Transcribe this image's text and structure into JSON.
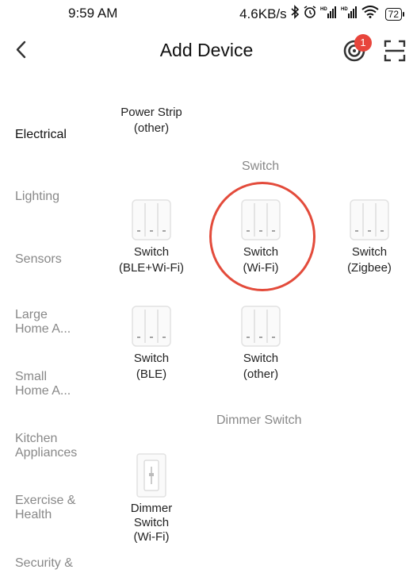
{
  "status_bar": {
    "time": "9:59 AM",
    "speed": "4.6KB/s",
    "battery": "72"
  },
  "header": {
    "title": "Add Device",
    "badge_count": "1"
  },
  "sidebar": {
    "items": [
      {
        "label": "Electrical",
        "active": true
      },
      {
        "label": "Lighting"
      },
      {
        "label": "Sensors"
      },
      {
        "label": "Large\nHome A..."
      },
      {
        "label": "Small\nHome A..."
      },
      {
        "label": "Kitchen\nAppliances"
      },
      {
        "label": "Exercise &\nHealth"
      },
      {
        "label": "Security &"
      }
    ]
  },
  "main": {
    "power_strip": {
      "label": "Power Strip\n(other)"
    },
    "switch_section": {
      "title": "Switch",
      "devices": [
        {
          "label": "Switch\n(BLE+Wi-Fi)"
        },
        {
          "label": "Switch\n(Wi-Fi)"
        },
        {
          "label": "Switch\n(Zigbee)"
        },
        {
          "label": "Switch\n(BLE)"
        },
        {
          "label": "Switch\n(other)"
        }
      ]
    },
    "dimmer_section": {
      "title": "Dimmer Switch",
      "devices": [
        {
          "label": "Dimmer\nSwitch\n(Wi-Fi)"
        }
      ]
    }
  },
  "colors": {
    "accent": "#e34b3b",
    "badge": "#e8453c"
  }
}
